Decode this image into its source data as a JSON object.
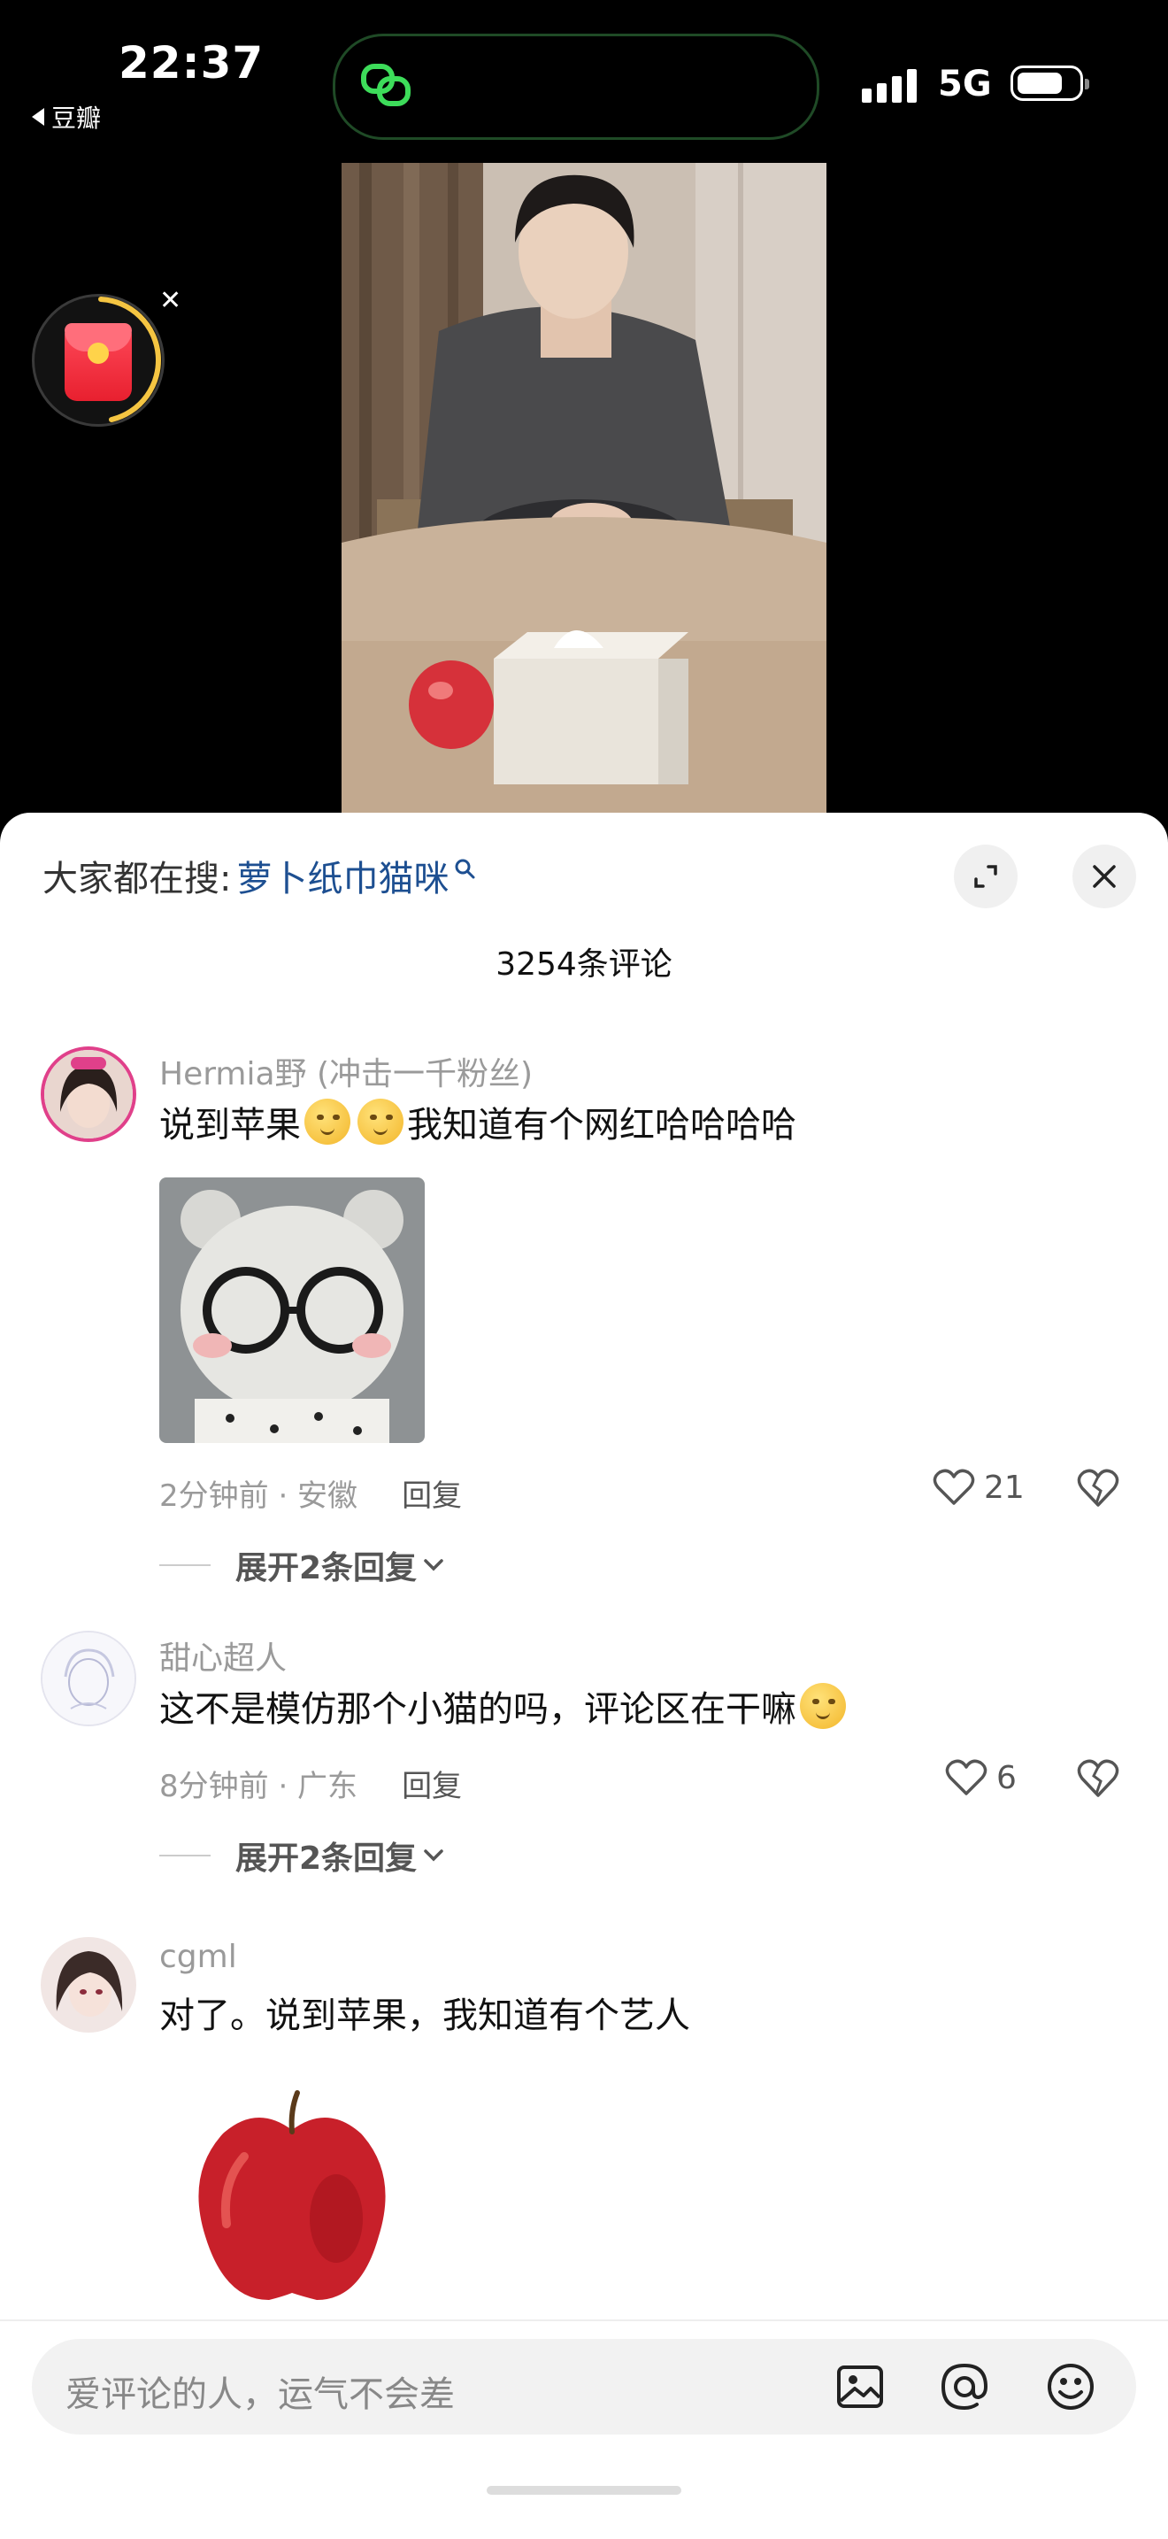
{
  "status_bar": {
    "time": "22:37",
    "back_app": "豆瓣",
    "network": "5G"
  },
  "trending": {
    "label": "大家都在搜:",
    "keyword": "萝卜纸巾猫咪"
  },
  "comments_count": "3254条评论",
  "comments": [
    {
      "username": "Hermia野 (冲击一千粉丝)",
      "text_before": "说到苹果",
      "text_after": "我知道有个网红哈哈哈哈",
      "time_location": "2分钟前 · 安徽",
      "reply_label": "回复",
      "likes": "21",
      "expand_label": "展开2条回复"
    },
    {
      "username": "甜心超人",
      "text": "这不是模仿那个小猫的吗，评论区在干嘛",
      "time_location": "8分钟前 · 广东",
      "reply_label": "回复",
      "likes": "6",
      "expand_label": "展开2条回复"
    },
    {
      "username": "cgml",
      "text": "对了。说到苹果，我知道有个艺人"
    }
  ],
  "input": {
    "placeholder": "爱评论的人，运气不会差"
  },
  "colors": {
    "keyword": "#1d4f91",
    "muted": "#9a9a9a",
    "island_ring": "#2ecc40"
  },
  "icons": [
    "back-arrow-icon",
    "chat-link-icon",
    "signal-icon",
    "battery-icon",
    "red-envelope-icon",
    "close-icon",
    "search-icon",
    "fullscreen-icon",
    "heart-icon",
    "broken-heart-icon",
    "chevron-down-icon",
    "image-icon",
    "at-icon",
    "emoji-icon"
  ]
}
